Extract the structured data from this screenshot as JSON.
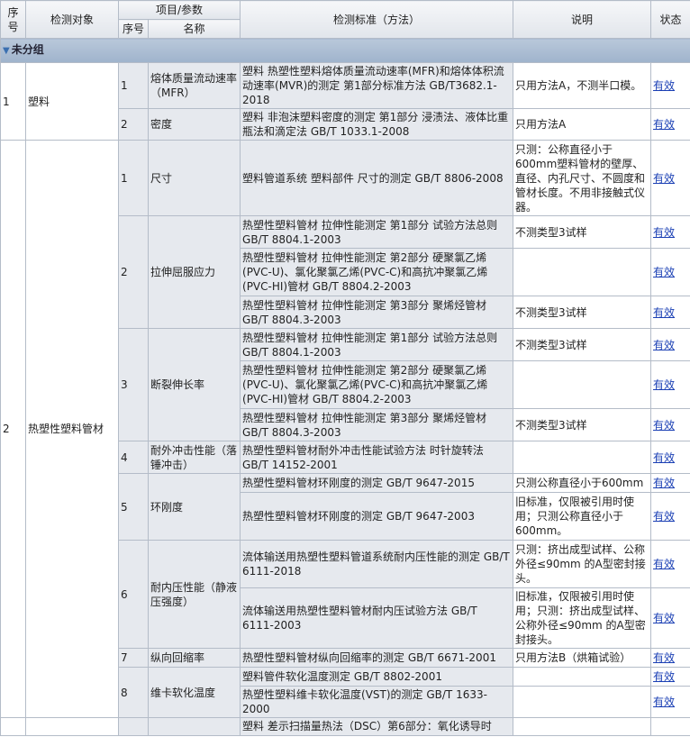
{
  "header": {
    "seq": "序号",
    "object": "检测对象",
    "item_param": "项目/参数",
    "item_seq": "序号",
    "item_name": "名称",
    "standard": "检测标准（方法）",
    "note": "说明",
    "status": "状态"
  },
  "group": "未分组",
  "objects": [
    {
      "seq": "1",
      "name": "塑料",
      "items": [
        {
          "seq": "1",
          "name": "熔体质量流动速率（MFR）",
          "standards": [
            {
              "std": "塑料 热塑性塑料熔体质量流动速率(MFR)和熔体体积流动速率(MVR)的测定 第1部分标准方法 GB/T3682.1-2018",
              "note": "只用方法A，不测半口模。",
              "status": "有效"
            }
          ]
        },
        {
          "seq": "2",
          "name": "密度",
          "standards": [
            {
              "std": "塑料 非泡沫塑料密度的测定 第1部分 浸渍法、液体比重瓶法和滴定法 GB/T 1033.1-2008",
              "note": "只用方法A",
              "status": "有效"
            }
          ]
        }
      ]
    },
    {
      "seq": "2",
      "name": "热塑性塑料管材",
      "items": [
        {
          "seq": "1",
          "name": "尺寸",
          "standards": [
            {
              "std": "塑料管道系统 塑料部件 尺寸的测定 GB/T 8806-2008",
              "note": "只测：公称直径小于600mm塑料管材的壁厚、直径、内孔尺寸、不圆度和管材长度。不用非接触式仪器。",
              "status": "有效"
            }
          ]
        },
        {
          "seq": "2",
          "name": "拉伸屈服应力",
          "standards": [
            {
              "std": "热塑性塑料管材 拉伸性能测定 第1部分 试验方法总则 GB/T 8804.1-2003",
              "note": "不测类型3试样",
              "status": "有效"
            },
            {
              "std": "热塑性塑料管材 拉伸性能测定 第2部分 硬聚氯乙烯(PVC-U)、氯化聚氯乙烯(PVC-C)和高抗冲聚氯乙烯(PVC-HI)管材 GB/T 8804.2-2003",
              "note": "",
              "status": "有效"
            },
            {
              "std": "热塑性塑料管材 拉伸性能测定 第3部分 聚烯烃管材 GB/T 8804.3-2003",
              "note": "不测类型3试样",
              "status": "有效"
            }
          ]
        },
        {
          "seq": "3",
          "name": "断裂伸长率",
          "standards": [
            {
              "std": "热塑性塑料管材 拉伸性能测定 第1部分 试验方法总则 GB/T 8804.1-2003",
              "note": "不测类型3试样",
              "status": "有效"
            },
            {
              "std": "热塑性塑料管材 拉伸性能测定 第2部分 硬聚氯乙烯(PVC-U)、氯化聚氯乙烯(PVC-C)和高抗冲聚氯乙烯(PVC-HI)管材 GB/T 8804.2-2003",
              "note": "",
              "status": "有效"
            },
            {
              "std": "热塑性塑料管材 拉伸性能测定 第3部分 聚烯烃管材 GB/T 8804.3-2003",
              "note": "不测类型3试样",
              "status": "有效"
            }
          ]
        },
        {
          "seq": "4",
          "name": "耐外冲击性能（落锤冲击）",
          "standards": [
            {
              "std": "热塑性塑料管材耐外冲击性能试验方法 时针旋转法 GB/T 14152-2001",
              "note": "",
              "status": "有效"
            }
          ]
        },
        {
          "seq": "5",
          "name": "环刚度",
          "standards": [
            {
              "std": "热塑性塑料管材环刚度的测定 GB/T 9647-2015",
              "note": "只测公称直径小于600mm",
              "status": "有效"
            },
            {
              "std": "热塑性塑料管材环刚度的测定 GB/T 9647-2003",
              "note": "旧标准，仅限被引用时使用；只测公称直径小于600mm。",
              "status": "有效"
            }
          ]
        },
        {
          "seq": "6",
          "name": "耐内压性能（静液压强度）",
          "standards": [
            {
              "std": "流体输送用热塑性塑料管道系统耐内压性能的测定 GB/T 6111-2018",
              "note": "只测：挤出成型试样、公称外径≤90mm 的A型密封接头。",
              "status": "有效"
            },
            {
              "std": "流体输送用热塑性塑料管材耐内压试验方法 GB/T 6111-2003",
              "note": "旧标准，仅限被引用时使用；只测：挤出成型试样、公称外径≤90mm 的A型密封接头。",
              "status": "有效"
            }
          ]
        },
        {
          "seq": "7",
          "name": "纵向回缩率",
          "standards": [
            {
              "std": "热塑性塑料管材纵向回缩率的测定 GB/T 6671-2001",
              "note": "只用方法B（烘箱试验）",
              "status": "有效"
            }
          ]
        },
        {
          "seq": "8",
          "name": "维卡软化温度",
          "standards": [
            {
              "std": "塑料管件软化温度测定 GB/T 8802-2001",
              "note": "",
              "status": "有效"
            },
            {
              "std": "热塑性塑料维卡软化温度(VST)的测定 GB/T 1633-2000",
              "note": "",
              "status": "有效"
            }
          ]
        }
      ]
    }
  ],
  "trailing_row_text": "塑料 差示扫描量热法（DSC）第6部分：氧化诱导时"
}
